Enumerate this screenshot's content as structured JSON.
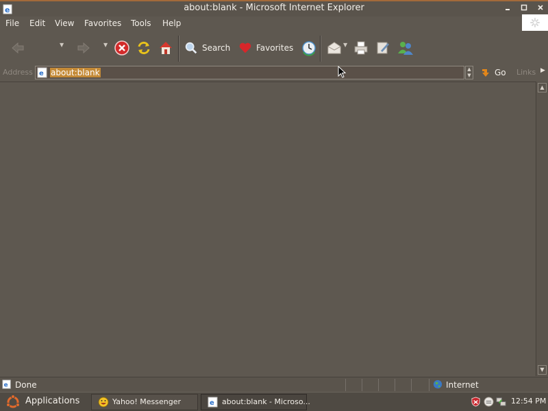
{
  "window": {
    "title": "about:blank - Microsoft Internet Explorer",
    "minimize_icon": "minimize-icon",
    "maximize_icon": "maximize-icon",
    "close_icon": "close-icon"
  },
  "menu": {
    "items": [
      "File",
      "Edit",
      "View",
      "Favorites",
      "Tools",
      "Help"
    ]
  },
  "toolbar": {
    "search_label": "Search",
    "favorites_label": "Favorites",
    "icons": [
      "back-icon",
      "forward-icon",
      "stop-icon",
      "refresh-icon",
      "home-icon",
      "search-icon",
      "favorites-icon",
      "history-icon",
      "mail-icon",
      "print-icon",
      "edit-icon",
      "messenger-icon"
    ]
  },
  "address": {
    "label": "Address",
    "value": "about:blank",
    "go_label": "Go",
    "links_label": "Links"
  },
  "status": {
    "text": "Done",
    "zone": "Internet"
  },
  "taskbar": {
    "applications_label": "Applications",
    "tasks": [
      {
        "label": "Yahoo! Messenger"
      },
      {
        "label": "about:blank - Microso..."
      }
    ],
    "clock": "12:54 PM"
  },
  "colors": {
    "background": "#5e5850",
    "title_accent": "#a36a3a",
    "selection": "#c48a37"
  }
}
